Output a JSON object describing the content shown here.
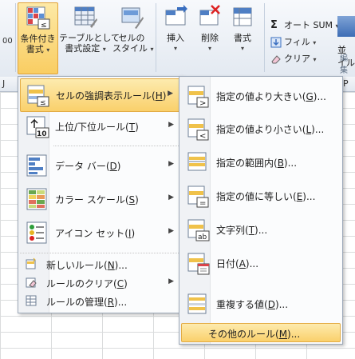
{
  "ribbon": {
    "styles_group": {
      "conditional_formatting": {
        "line1": "条件付き",
        "line2": "書式"
      },
      "format_as_table": {
        "line1": "テーブルとして",
        "line2": "書式設定"
      },
      "cell_styles": {
        "line1": "セルの",
        "line2": "スタイル"
      }
    },
    "cells_group": {
      "insert": "挿入",
      "delete": "削除",
      "format": "書式"
    },
    "editing_group": {
      "autosum": "オート SUM",
      "fill": "フィル",
      "clear": "クリア",
      "partial_1": "並",
      "partial_2": "イル",
      "partial_label": "編集"
    },
    "number_partial": "00",
    "column_letters": [
      "J",
      "P"
    ]
  },
  "menu_main": {
    "items": [
      {
        "label": "セルの強調表示ルール(",
        "key": "H",
        "tail": ")",
        "highlighted": true
      },
      {
        "label": "上位/下位ルール(",
        "key": "T",
        "tail": ")"
      },
      {
        "label": "データ バー(",
        "key": "D",
        "tail": ")"
      },
      {
        "label": "カラー スケール(",
        "key": "S",
        "tail": ")"
      },
      {
        "label": "アイコン セット(",
        "key": "I",
        "tail": ")"
      }
    ],
    "small_items": [
      {
        "label": "新しいルール(",
        "key": "N",
        "tail": ")..."
      },
      {
        "label": "ルールのクリア(",
        "key": "C",
        "tail": ")"
      },
      {
        "label": "ルールの管理(",
        "key": "R",
        "tail": ")..."
      }
    ]
  },
  "menu_sub": {
    "items": [
      {
        "label": "指定の値より大きい(",
        "key": "G",
        "tail": ")..."
      },
      {
        "label": "指定の値より小さい(",
        "key": "L",
        "tail": ")..."
      },
      {
        "label": "指定の範囲内(",
        "key": "B",
        "tail": ")..."
      },
      {
        "label": "指定の値に等しい(",
        "key": "E",
        "tail": ")..."
      },
      {
        "label": "文字列(",
        "key": "T",
        "tail": ")..."
      },
      {
        "label": "日付(",
        "key": "A",
        "tail": ")..."
      },
      {
        "label": "重複する値(",
        "key": "D",
        "tail": ")..."
      }
    ],
    "more_rules": {
      "label": "その他のルール(",
      "key": "M",
      "tail": ")..."
    }
  },
  "colors": {
    "highlight": "#fad06b",
    "menu_border": "#9ca8b8",
    "ribbon_bg": "#e3e9f1"
  }
}
